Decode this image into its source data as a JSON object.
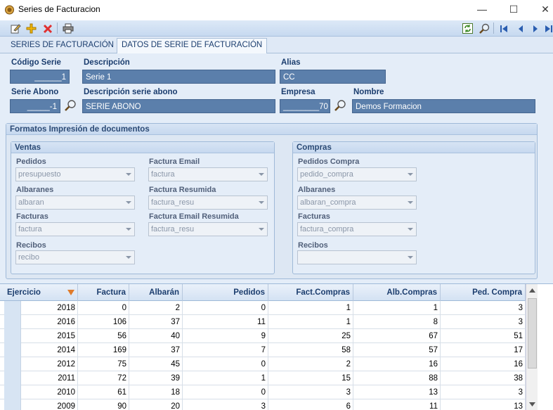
{
  "window": {
    "title": "Series de Facturacion"
  },
  "tabs": [
    {
      "label": "SERIES DE FACTURACIÓN"
    },
    {
      "label": "DATOS DE SERIE DE FACTURACIÓN"
    }
  ],
  "header": {
    "codigo_serie": {
      "label": "Código Serie",
      "value": "______1"
    },
    "descripcion": {
      "label": "Descripción",
      "value": "Serie 1"
    },
    "alias": {
      "label": "Alias",
      "value": "CC"
    },
    "serie_abono": {
      "label": "Serie Abono",
      "value": "_____-1"
    },
    "descripcion_abono": {
      "label": "Descripción serie abono",
      "value": "SERIE ABONO"
    },
    "empresa": {
      "label": "Empresa",
      "value": "________70"
    },
    "nombre": {
      "label": "Nombre",
      "value": "Demos Formacion"
    }
  },
  "formats": {
    "title": "Formatos Impresión de documentos",
    "ventas": {
      "title": "Ventas",
      "pedidos": {
        "label": "Pedidos",
        "value": "presupuesto"
      },
      "albaranes": {
        "label": "Albaranes",
        "value": "albaran"
      },
      "facturas": {
        "label": "Facturas",
        "value": "factura"
      },
      "recibos": {
        "label": "Recibos",
        "value": "recibo"
      },
      "factura_email": {
        "label": "Factura Email",
        "value": "factura"
      },
      "factura_resumida": {
        "label": "Factura Resumida",
        "value": "factura_resu"
      },
      "factura_email_resumida": {
        "label": "Factura Email Resumida",
        "value": "factura_resu"
      }
    },
    "compras": {
      "title": "Compras",
      "pedidos": {
        "label": "Pedidos Compra",
        "value": "pedido_compra"
      },
      "albaranes": {
        "label": "Albaranes",
        "value": "albaran_compra"
      },
      "facturas": {
        "label": "Facturas",
        "value": "factura_compra"
      },
      "recibos": {
        "label": "Recibos",
        "value": ""
      }
    }
  },
  "table": {
    "columns": [
      "Ejercicio",
      "Factura",
      "Albarán",
      "Pedidos",
      "Fact.Compras",
      "Alb.Compras",
      "Ped. Compra"
    ],
    "rows": [
      [
        "2018",
        "0",
        "2",
        "0",
        "1",
        "1",
        "3"
      ],
      [
        "2016",
        "106",
        "37",
        "11",
        "1",
        "8",
        "3"
      ],
      [
        "2015",
        "56",
        "40",
        "9",
        "25",
        "67",
        "51"
      ],
      [
        "2014",
        "169",
        "37",
        "7",
        "58",
        "57",
        "17"
      ],
      [
        "2012",
        "75",
        "45",
        "0",
        "2",
        "16",
        "16"
      ],
      [
        "2011",
        "72",
        "39",
        "1",
        "15",
        "88",
        "38"
      ],
      [
        "2010",
        "61",
        "18",
        "0",
        "3",
        "13",
        "3"
      ],
      [
        "2009",
        "90",
        "20",
        "3",
        "6",
        "11",
        "13"
      ]
    ]
  }
}
